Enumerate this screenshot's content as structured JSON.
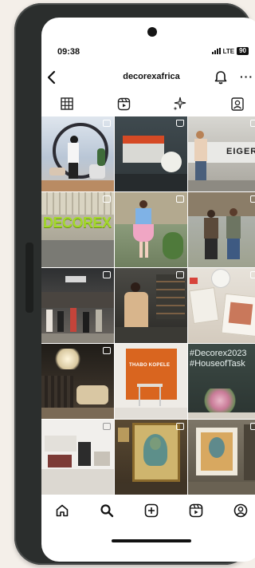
{
  "status": {
    "time": "09:38",
    "network": "LTE",
    "battery": "90"
  },
  "header": {
    "title": "decorexafrica",
    "more": "···"
  },
  "tabs": [
    {
      "name": "grid",
      "icon": "grid-icon"
    },
    {
      "name": "reels",
      "icon": "reels-icon"
    },
    {
      "name": "sparkle",
      "icon": "sparkle-icon"
    },
    {
      "name": "tagged",
      "icon": "tagged-icon"
    }
  ],
  "posts": [
    {
      "type": "reel",
      "text": ""
    },
    {
      "type": "shop",
      "text": ""
    },
    {
      "type": "reel",
      "text": "EIGER"
    },
    {
      "type": "reel",
      "text": "DECOREX"
    },
    {
      "type": "reel",
      "text": ""
    },
    {
      "type": "reel",
      "text": ""
    },
    {
      "type": "post",
      "text": ""
    },
    {
      "type": "reel",
      "text": ""
    },
    {
      "type": "post",
      "text": ""
    },
    {
      "type": "reel",
      "text": ""
    },
    {
      "type": "post",
      "text": "THABO KOPELE"
    },
    {
      "type": "post",
      "text": "#Decorex2023 #HouseofTask"
    },
    {
      "type": "post",
      "text": ""
    },
    {
      "type": "reel",
      "text": ""
    },
    {
      "type": "reel",
      "text": ""
    }
  ],
  "bottom_nav": [
    {
      "name": "home",
      "icon": "home-icon"
    },
    {
      "name": "search",
      "icon": "search-icon"
    },
    {
      "name": "create",
      "icon": "plus-icon"
    },
    {
      "name": "reels",
      "icon": "reels-icon"
    },
    {
      "name": "profile",
      "icon": "profile-icon"
    }
  ]
}
